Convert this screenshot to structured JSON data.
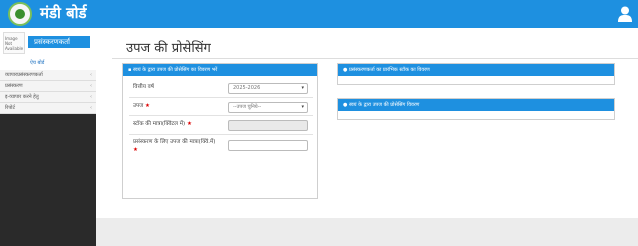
{
  "header": {
    "brand": "मंडी बोर्ड"
  },
  "sidebar": {
    "profile_name": "प्रसंस्करणकर्ता",
    "profile_link": "ऐच बोर्ड",
    "avatar_text": "Image Not Available",
    "items": [
      {
        "label": "व्यापारप्रसंस्करणकर्ता"
      },
      {
        "label": "प्रसंस्करण"
      },
      {
        "label": "इ-व्यापार करने हेतु"
      },
      {
        "label": "रिपोर्ट"
      }
    ]
  },
  "page": {
    "title": "उपज की प्रोसेसिंग"
  },
  "left_panel": {
    "title": "स्वयं के द्वारा उपज की प्रोसेसिंग का विवरण भरें",
    "fields": [
      {
        "label": "वित्तीय वर्ष",
        "value": "2025-2026"
      },
      {
        "label": "उपज",
        "value": "--उपज चुनिये--"
      },
      {
        "label": "स्टॉक की मात्रा(क्विंटल में)",
        "value": ""
      },
      {
        "label": "प्रसंस्करण के लिए उपज की मात्रा(क्विं.में)",
        "value": ""
      }
    ]
  },
  "right_panels": [
    {
      "title": "प्रसंस्करणकर्ता का प्रारंभिक स्टॉक का विवरण"
    },
    {
      "title": "स्वयं के द्वारा उपज की प्रोसेसिंग विवरण"
    }
  ],
  "colors": {
    "primary": "#1e90e0",
    "sidebar": "#2a2a2a",
    "required": "#dd0000"
  }
}
